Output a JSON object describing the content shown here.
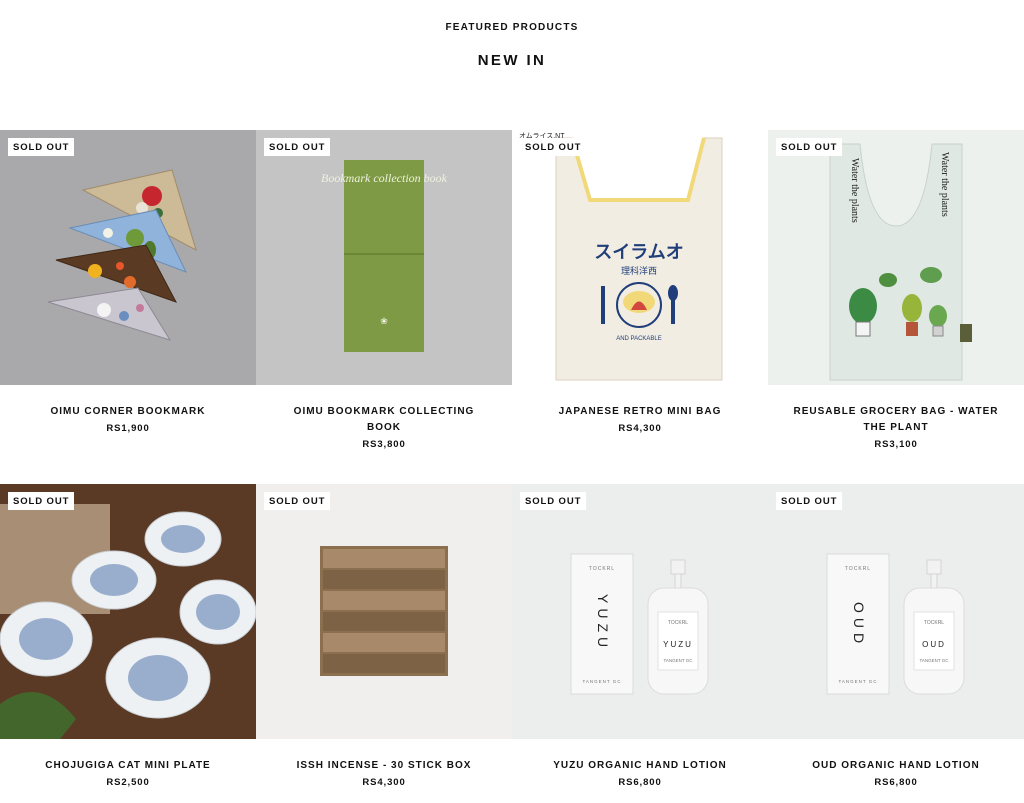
{
  "header": {
    "eyebrow": "FEATURED PRODUCTS",
    "title": "NEW IN"
  },
  "products": [
    {
      "name": "OIMU CORNER BOOKMARK",
      "price": "RS1,900",
      "badge": "SOLD OUT"
    },
    {
      "name": "OIMU BOOKMARK COLLECTING BOOK",
      "price": "RS3,800",
      "badge": "SOLD OUT",
      "cover_text": "Bookmark collection book"
    },
    {
      "name": "JAPANESE RETRO MINI BAG",
      "price": "RS4,300",
      "badge": "SOLD OUT",
      "bag_text": "スイラムオ",
      "bag_subtext": "理科洋西",
      "corner_text": "オムライス.NT",
      "bag_footer": "AND PACKABLE"
    },
    {
      "name": "REUSABLE GROCERY BAG - WATER THE PLANT",
      "price": "RS3,100",
      "badge": "SOLD OUT",
      "strap_text": "Water the plants"
    },
    {
      "name": "CHOJUGIGA CAT MINI PLATE",
      "price": "RS2,500",
      "badge": "SOLD OUT"
    },
    {
      "name": "ISSH INCENSE - 30 STICK BOX",
      "price": "RS4,300",
      "badge": "SOLD OUT"
    },
    {
      "name": "YUZU ORGANIC HAND LOTION",
      "price": "RS6,800",
      "badge": "SOLD OUT",
      "scent": "YUZU",
      "brand": "TOCKRL",
      "maker": "TANGENT GC"
    },
    {
      "name": "OUD ORGANIC HAND LOTION",
      "price": "RS6,800",
      "badge": "SOLD OUT",
      "scent": "OUD",
      "brand": "TOCKRL",
      "maker": "TANGENT GC"
    }
  ]
}
